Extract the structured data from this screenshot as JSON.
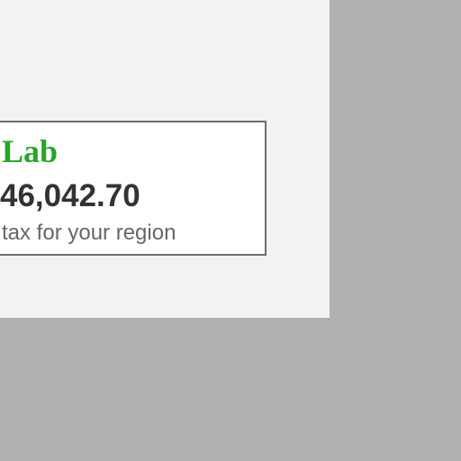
{
  "card": {
    "brand": "Lab",
    "price": "46,042.70",
    "tax_note": "tax for your region"
  },
  "colors": {
    "backdrop": "#b0b0b0",
    "panel": "#f2f2f2",
    "card_border": "#6e6e6e",
    "brand": "#2ba32b",
    "price": "#333333",
    "note": "#666666"
  }
}
